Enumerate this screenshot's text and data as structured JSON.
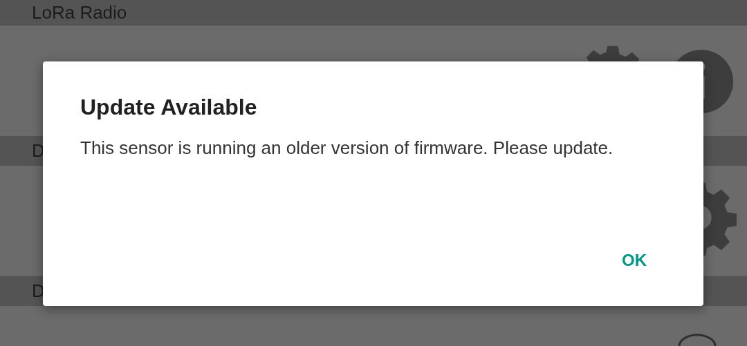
{
  "sections": [
    {
      "header": "LoRa Radio"
    },
    {
      "header": "D"
    },
    {
      "header": "D"
    }
  ],
  "dialog": {
    "title": "Update Available",
    "message": "This sensor is running an older version of firmware.  Please update.",
    "buttons": [
      "OK"
    ]
  }
}
